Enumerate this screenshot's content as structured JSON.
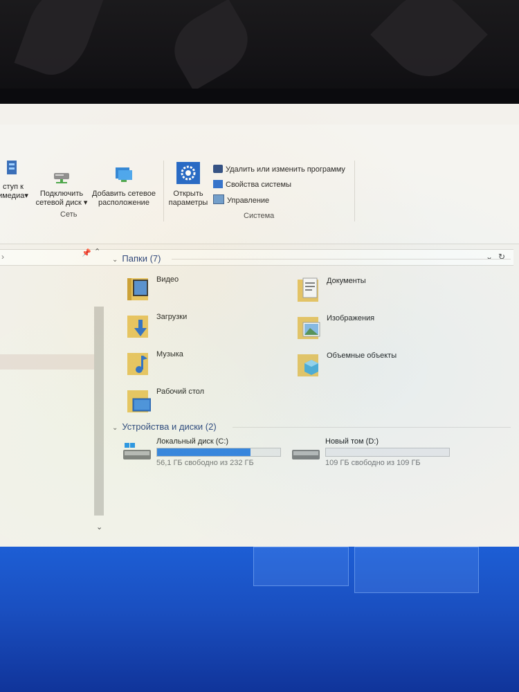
{
  "ribbon": {
    "btn_media_l1": "ступ к",
    "btn_media_l2": "имедиа",
    "btn_map_l1": "Подключить",
    "btn_map_l2": "сетевой диск",
    "btn_addnet_l1": "Добавить сетевое",
    "btn_addnet_l2": "расположение",
    "group_network": "Сеть",
    "btn_open_params_l1": "Открыть",
    "btn_open_params_l2": "параметры",
    "sys_uninstall": "Удалить или изменить программу",
    "sys_properties": "Свойства системы",
    "sys_manage": "Управление",
    "group_system": "Система"
  },
  "folders": {
    "header": "Папки (7)",
    "items": [
      "Видео",
      "Документы",
      "Загрузки",
      "Изображения",
      "Музыка",
      "Объемные объекты",
      "Рабочий стол"
    ]
  },
  "drives": {
    "header": "Устройства и диски (2)",
    "items": [
      {
        "name": "Локальный диск (C:)",
        "free": "56,1 ГБ свободно из 232 ГБ",
        "used_fraction": 0.76
      },
      {
        "name": "Новый том (D:)",
        "free": "109 ГБ свободно из 109 ГБ",
        "used_fraction": 0.0
      }
    ]
  },
  "colors": {
    "accent": "#2b7de0",
    "desktop": "#1a4fc0",
    "section_header": "#1e3a78"
  }
}
